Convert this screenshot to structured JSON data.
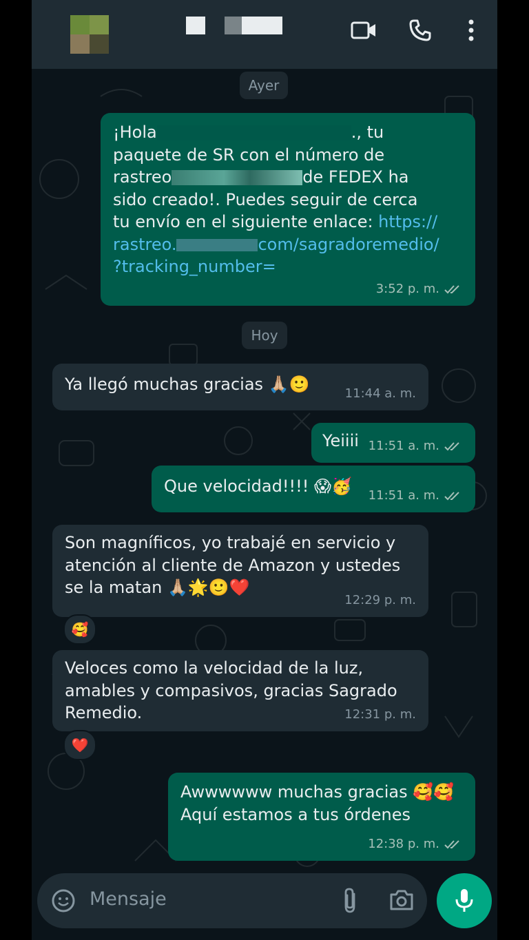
{
  "header": {
    "icons": [
      "video-call-icon",
      "phone-icon",
      "more-options-icon"
    ]
  },
  "chat": {
    "date_yesterday": "Ayer",
    "date_today": "Hoy",
    "messages": [
      {
        "direction": "outgoing",
        "line1": "¡Hola",
        "line1_end": "., tu",
        "line2": "paquete de SR con el número de",
        "line3_start": "rastreo",
        "line3_end": "de FEDEX ha",
        "line4": "sido creado!. Puedes seguir de cerca",
        "line5": "tu envío en el siguiente enlace: ",
        "link1": "https://",
        "link2_start": "rastreo.",
        "link2_end": "com/sagradoremedio/",
        "link3": "?tracking_number=",
        "time": "3:52 p. m."
      },
      {
        "direction": "incoming",
        "text": "Ya llegó muchas gracias 🙏🏼🙂",
        "time": "11:44 a. m."
      },
      {
        "direction": "outgoing",
        "text": "Yeiiii",
        "time": "11:51 a. m."
      },
      {
        "direction": "outgoing",
        "text": "Que velocidad!!!! 😱🥳",
        "time": "11:51 a. m."
      },
      {
        "direction": "incoming",
        "text": "Son magníficos, yo trabajé en servicio y\natención al cliente de Amazon y ustedes\nse la matan 🙏🏼🌟🙂❤️",
        "time": "12:29 p. m.",
        "reaction": "🥰"
      },
      {
        "direction": "incoming",
        "text": "Veloces como la velocidad de la luz,\namables y compasivos, gracias Sagrado\nRemedio.",
        "time": "12:31 p. m.",
        "reaction": "❤️"
      },
      {
        "direction": "outgoing",
        "text": "Awwwwww muchas gracias 🥰🥰\nAquí estamos a tus órdenes",
        "time": "12:38 p. m."
      }
    ]
  },
  "composer": {
    "placeholder": "Mensaje",
    "icons": [
      "emoji-icon",
      "attach-icon",
      "camera-icon",
      "mic-icon"
    ]
  },
  "colors": {
    "background": "#0b141a",
    "header": "#1f2c34",
    "outgoing_bubble": "#005c4b",
    "incoming_bubble": "#1f2c34",
    "link": "#53bdeb",
    "accent": "#00a884"
  }
}
